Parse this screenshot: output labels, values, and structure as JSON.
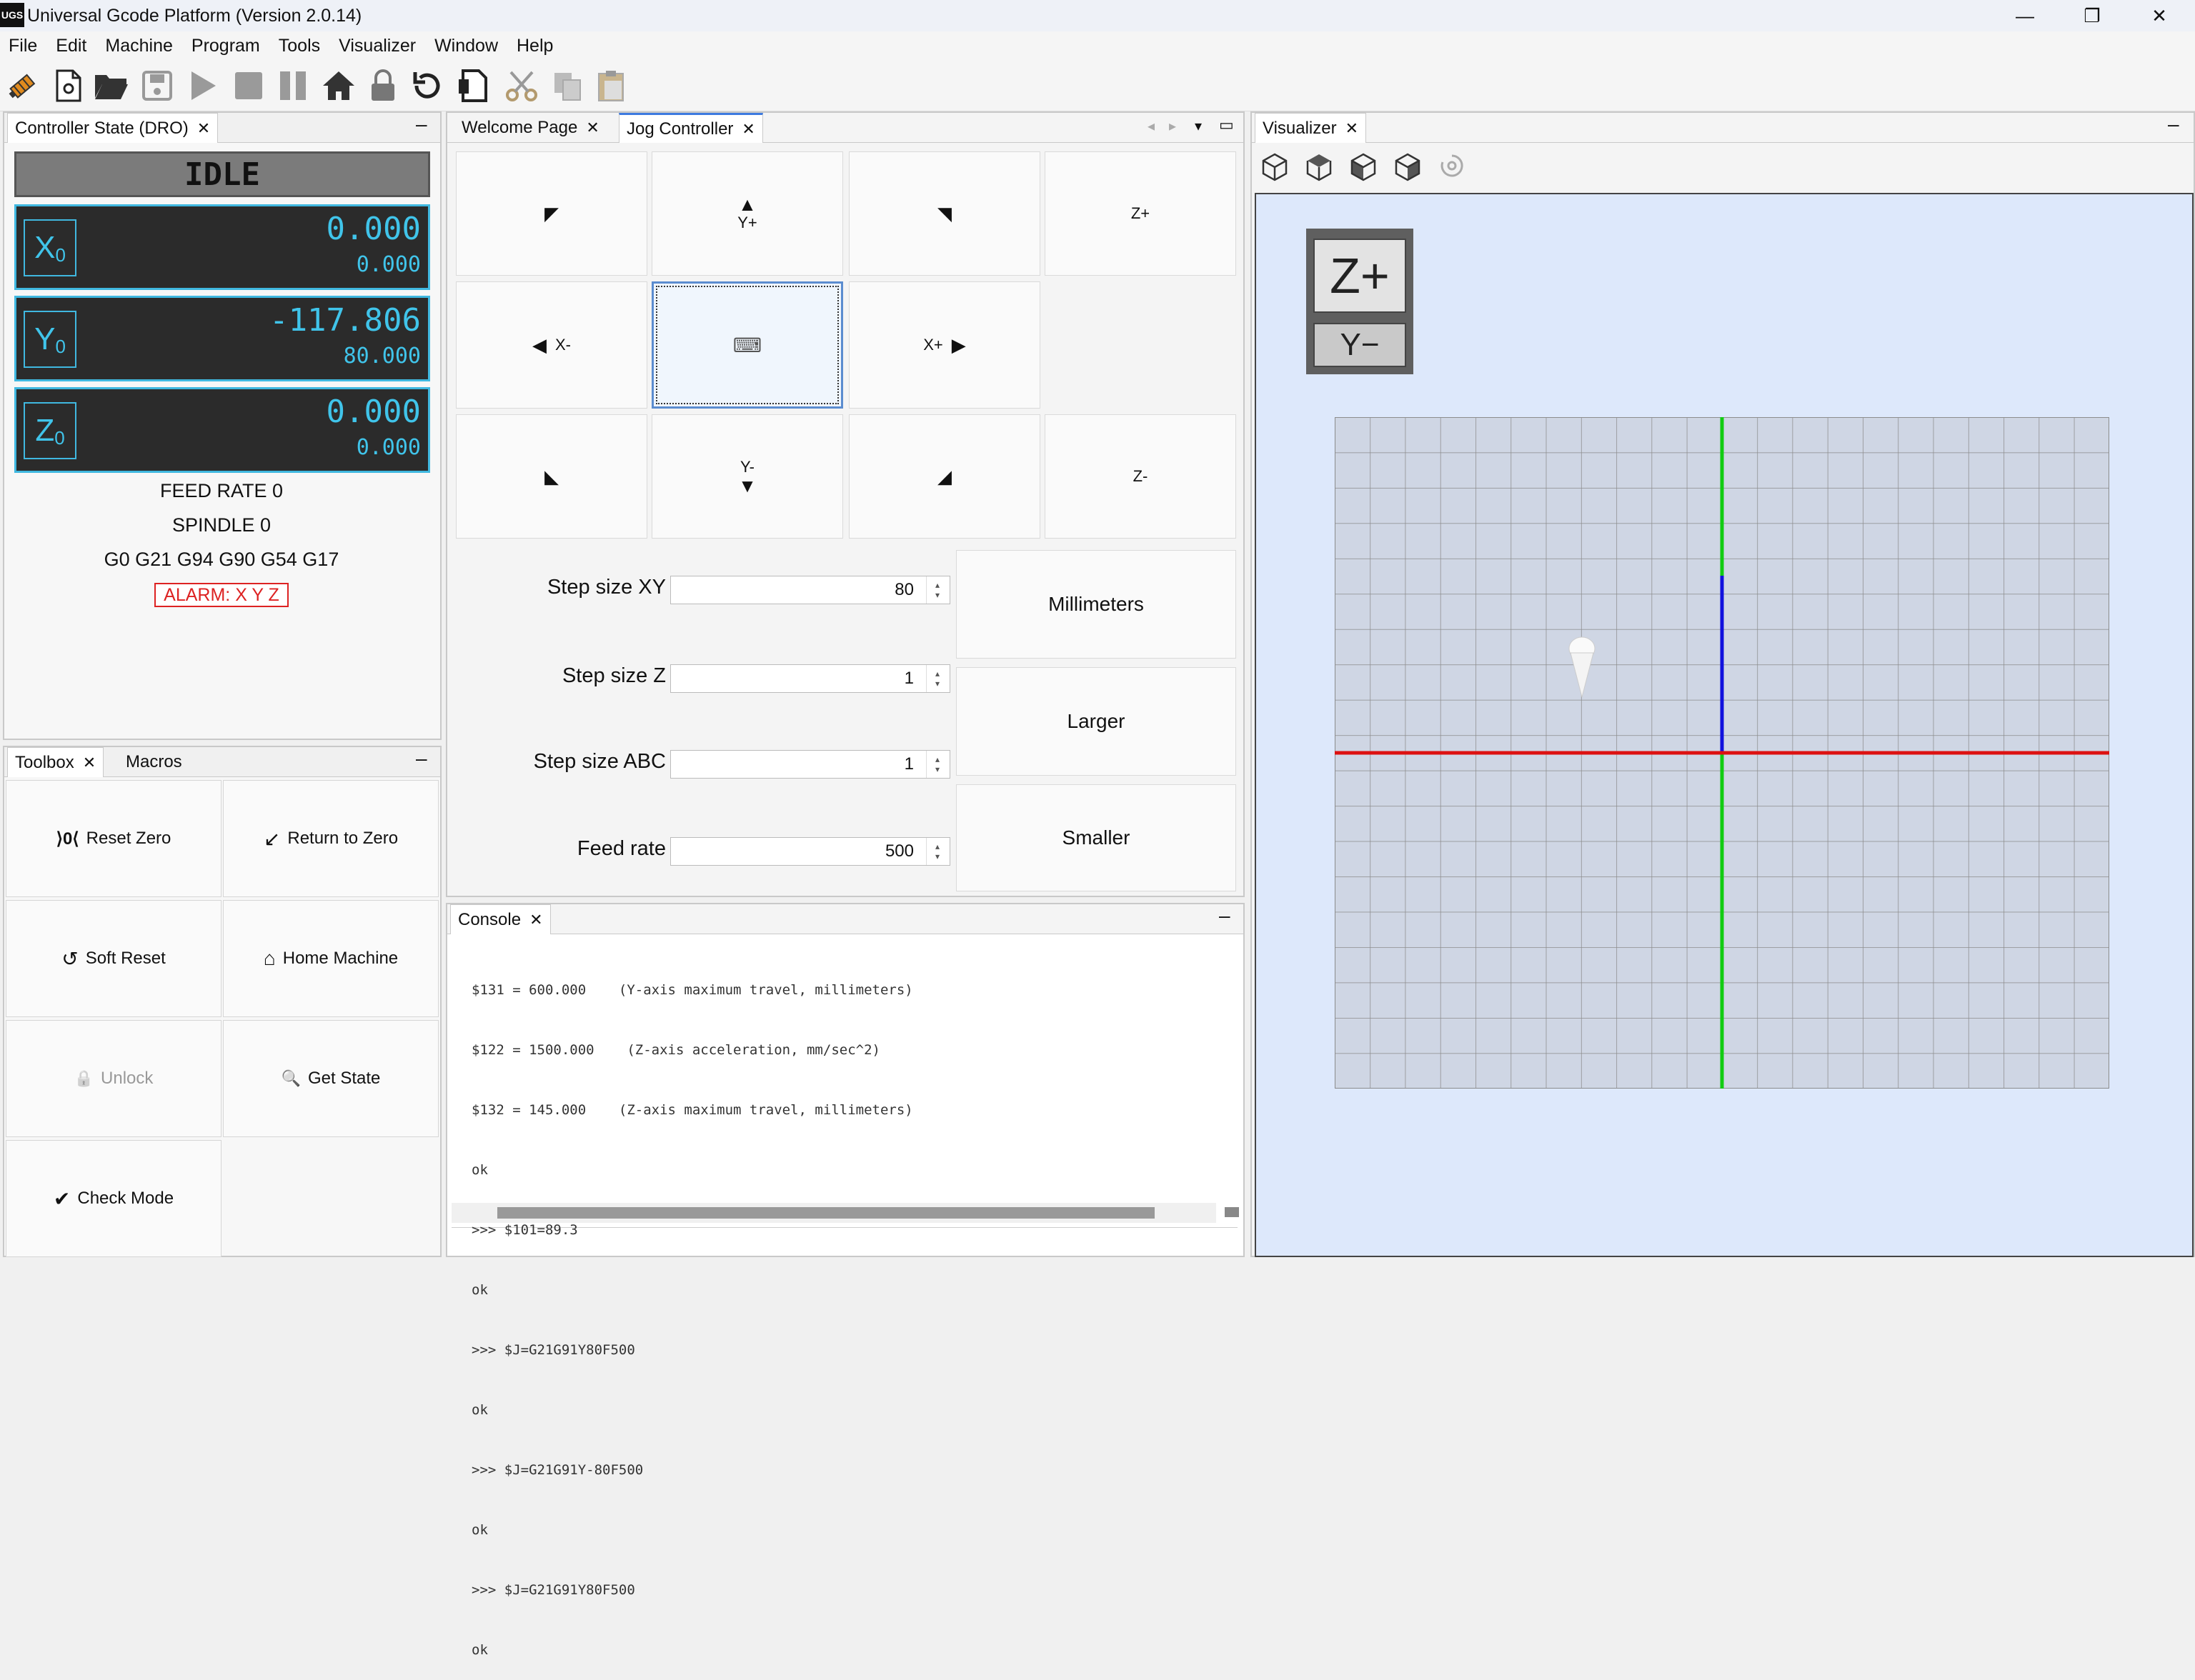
{
  "window": {
    "title": "Universal Gcode Platform (Version 2.0.14)",
    "logo": "UGS",
    "controls": {
      "minimize": "—",
      "restore": "❐",
      "close": "✕"
    }
  },
  "menu": [
    "File",
    "Edit",
    "Machine",
    "Program",
    "Tools",
    "Visualizer",
    "Window",
    "Help"
  ],
  "toolbar_icons": [
    "connect-icon",
    "new-file-icon",
    "open-folder-icon",
    "save-icon",
    "play-icon",
    "stop-icon",
    "pause-icon",
    "home-icon",
    "lock-icon",
    "reset-icon",
    "gcode-file-icon",
    "cut-icon",
    "copy-icon",
    "paste-icon"
  ],
  "dro": {
    "tab": "Controller State (DRO)",
    "state": "IDLE",
    "axes": [
      {
        "label": "X",
        "sub": "0",
        "work": "0.000",
        "machine": "0.000"
      },
      {
        "label": "Y",
        "sub": "0",
        "work": "-117.806",
        "machine": "80.000"
      },
      {
        "label": "Z",
        "sub": "0",
        "work": "0.000",
        "machine": "0.000"
      }
    ],
    "feed_rate": "FEED RATE 0",
    "spindle": "SPINDLE 0",
    "gcode_state": "G0 G21 G94 G90 G54 G17",
    "alarm": "ALARM: X Y Z"
  },
  "toolbox": {
    "tabs": [
      "Toolbox",
      "Macros"
    ],
    "buttons": [
      {
        "label": "Reset Zero",
        "icon": "reset-zero-icon",
        "glyph": "⟩0⟨"
      },
      {
        "label": "Return to Zero",
        "icon": "return-to-zero-icon",
        "glyph": "↙"
      },
      {
        "label": "Soft Reset",
        "icon": "soft-reset-icon",
        "glyph": "↺"
      },
      {
        "label": "Home Machine",
        "icon": "home-icon",
        "glyph": "⌂"
      },
      {
        "label": "Unlock",
        "icon": "lock-icon",
        "glyph": "🔒"
      },
      {
        "label": "Get State",
        "icon": "search-icon",
        "glyph": "🔍"
      },
      {
        "label": "Check Mode",
        "icon": "check-icon",
        "glyph": "✔"
      }
    ]
  },
  "center_tabs": [
    "Welcome Page",
    "Jog Controller"
  ],
  "jog": {
    "y_plus": "Y+",
    "y_minus": "Y-",
    "x_minus": "X-",
    "x_plus": "X+",
    "z_plus": "Z+",
    "z_minus": "Z-",
    "keyboard_glyph": "⌨",
    "step_xy_label": "Step size XY",
    "step_xy": "80",
    "step_z_label": "Step size Z",
    "step_z": "1",
    "step_abc_label": "Step size ABC",
    "step_abc": "1",
    "feed_label": "Feed rate",
    "feed": "500",
    "units_btn": "Millimeters",
    "larger_btn": "Larger",
    "smaller_btn": "Smaller"
  },
  "console": {
    "tab": "Console",
    "lines": [
      "$131 = 600.000    (Y-axis maximum travel, millimeters)",
      "$122 = 1500.000    (Z-axis acceleration, mm/sec^2)",
      "$132 = 145.000    (Z-axis maximum travel, millimeters)",
      "ok",
      ">>> $101=89.3",
      "ok",
      ">>> $J=G21G91Y80F500",
      "ok",
      ">>> $J=G21G91Y-80F500",
      "ok",
      ">>> $J=G21G91Y80F500",
      "ok"
    ]
  },
  "visualizer": {
    "tab": "Visualizer",
    "view_icons": [
      "view-iso-icon",
      "view-top-icon",
      "view-front-icon",
      "view-side-icon",
      "rotate-icon"
    ],
    "cube_top": "Z+",
    "cube_front": "Y−",
    "colors": {
      "x_axis": "#dd1111",
      "y_axis": "#11cc11",
      "z_axis": "#1111dd",
      "background": "#dde8fb",
      "dro_accent": "#40c4ea"
    }
  }
}
